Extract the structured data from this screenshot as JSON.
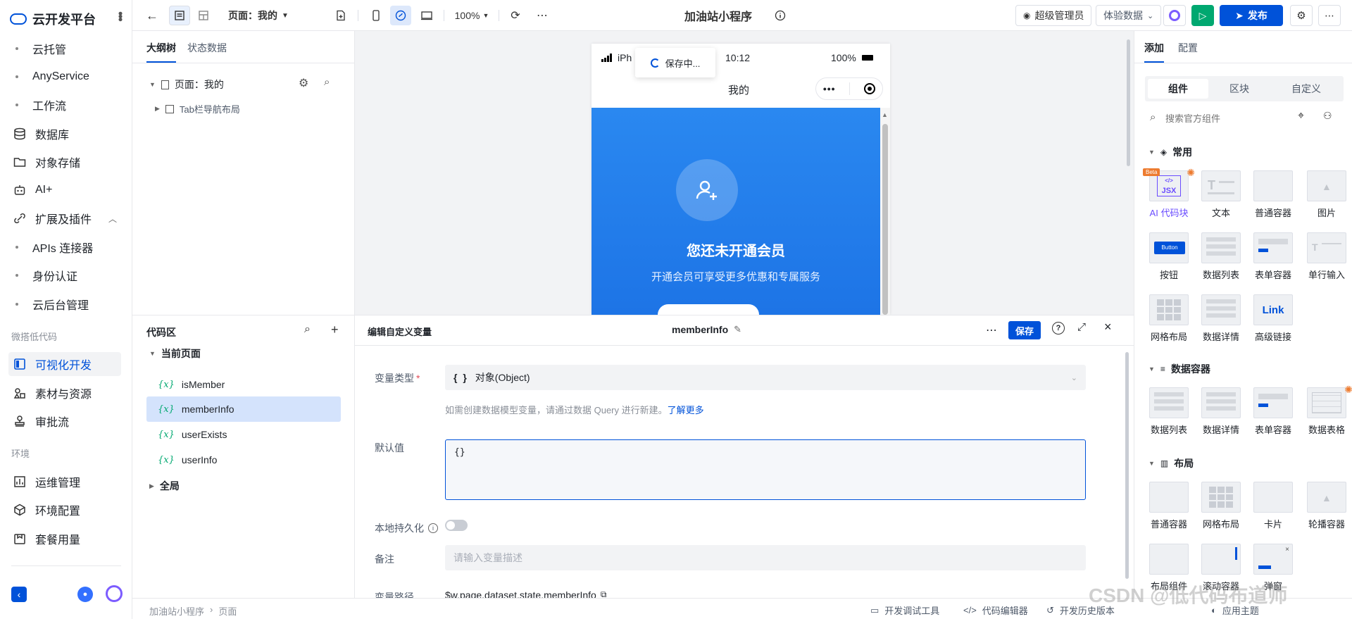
{
  "sidebar": {
    "brand": "云开发平台",
    "items": [
      {
        "label": "云托管",
        "type": "sub"
      },
      {
        "label": "AnyService",
        "type": "sub"
      },
      {
        "label": "工作流",
        "type": "sub"
      },
      {
        "label": "数据库",
        "type": "main",
        "icon": "database-icon"
      },
      {
        "label": "对象存储",
        "type": "main",
        "icon": "folder-icon"
      },
      {
        "label": "AI+",
        "type": "main",
        "icon": "robot-icon"
      },
      {
        "label": "扩展及插件",
        "type": "main",
        "icon": "plugin-icon"
      },
      {
        "label": "APIs 连接器",
        "type": "sub"
      },
      {
        "label": "身份认证",
        "type": "sub"
      },
      {
        "label": "云后台管理",
        "type": "sub"
      }
    ],
    "group_lowcode": "微搭低代码",
    "lowcode_items": [
      {
        "label": "可视化开发",
        "icon": "layout-icon",
        "active": true
      },
      {
        "label": "素材与资源",
        "icon": "assets-icon"
      },
      {
        "label": "审批流",
        "icon": "stamp-icon"
      }
    ],
    "group_env": "环境",
    "env_items": [
      {
        "label": "运维管理",
        "icon": "chart-icon"
      },
      {
        "label": "环境配置",
        "icon": "cube-icon"
      },
      {
        "label": "套餐用量",
        "icon": "package-icon"
      }
    ]
  },
  "toolbar": {
    "page_label": "页面：我的",
    "zoom": "100%",
    "app_title": "加油站小程序",
    "admin_label": "超级管理员",
    "data_label": "体验数据",
    "publish_label": "发布"
  },
  "outline": {
    "tab_tree": "大纲树",
    "tab_state": "状态数据",
    "page_node": "页面：我的",
    "child_node": "Tab栏导航布局"
  },
  "code": {
    "title": "代码区",
    "current_page": "当前页面",
    "vars": [
      "isMember",
      "memberInfo",
      "userExists",
      "userInfo"
    ],
    "global": "全局"
  },
  "phone": {
    "carrier": "iPh",
    "saving": "保存中...",
    "time": "10:12",
    "battery": "100%",
    "page_title": "我的",
    "hero_title": "您还未开通会员",
    "hero_subtitle": "开通会员可享受更多优惠和专属服务"
  },
  "editor": {
    "title": "编辑自定义变量",
    "var_name": "memberInfo",
    "save_label": "保存",
    "type_label": "变量类型",
    "type_value": "对象(Object)",
    "type_icon": "{ }",
    "hint_text": "如需创建数据模型变量，请通过数据 Query 进行新建。",
    "hint_link": "了解更多",
    "default_label": "默认值",
    "default_value": "{}",
    "persist_label": "本地持久化",
    "remark_label": "备注",
    "remark_placeholder": "请输入变量描述",
    "path_label": "变量路径",
    "path_value": "$w.page.dataset.state.memberInfo"
  },
  "rightpanel": {
    "tab_add": "添加",
    "tab_config": "配置",
    "seg": [
      "组件",
      "区块",
      "自定义"
    ],
    "search_placeholder": "搜索官方组件",
    "sec_common": "常用",
    "common": [
      "AI 代码块",
      "文本",
      "普通容器",
      "图片",
      "按钮",
      "数据列表",
      "表单容器",
      "单行输入",
      "网格布局",
      "数据详情",
      "高级链接"
    ],
    "jsx_badge": "Beta",
    "jsx_text": "JSX",
    "button_thumb": "Button",
    "link_thumb": "Link",
    "sec_data": "数据容器",
    "data": [
      "数据列表",
      "数据详情",
      "表单容器",
      "数据表格"
    ],
    "sec_layout": "布局",
    "layout": [
      "普通容器",
      "网格布局",
      "卡片",
      "轮播容器",
      "布局组件",
      "滚动容器",
      "弹窗"
    ]
  },
  "statusbar": {
    "breadcrumb": [
      "加油站小程序",
      "页面"
    ],
    "debug": "开发调试工具",
    "code_editor": "代码编辑器",
    "history": "开发历史版本",
    "theme": "应用主题"
  },
  "watermark": "CSDN @低代码布道师"
}
